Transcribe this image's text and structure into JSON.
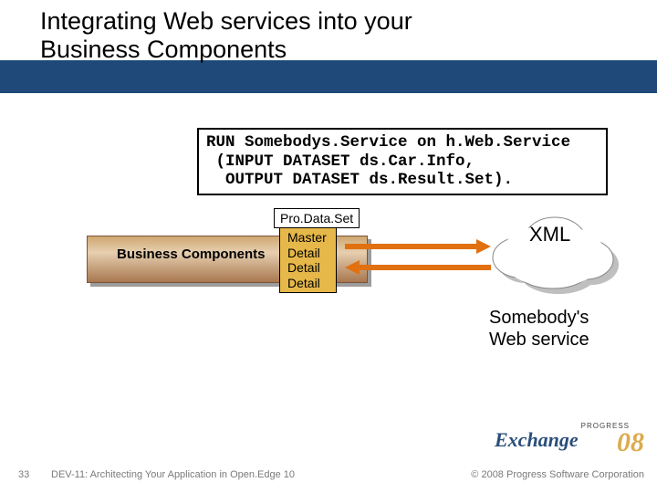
{
  "title": "Integrating Web services into your\nBusiness Components",
  "code": "RUN Somebodys.Service on h.Web.Service\n (INPUT DATASET ds.Car.Info,\n  OUTPUT DATASET ds.Result.Set).",
  "prodataset": "Pro.Data.Set",
  "biz_label": "Business Components",
  "master_detail": "Master\nDetail\nDetail\nDetail",
  "cloud_label": "XML",
  "svc_label": "Somebody's\nWeb service",
  "footer": {
    "slide_num": "33",
    "title": "DEV-11: Architecting Your Application in Open.Edge 10",
    "copyright": "© 2008 Progress Software Corporation"
  },
  "logo": {
    "progress": "PROGRESS",
    "exchange": "Exchange",
    "year": "08"
  }
}
